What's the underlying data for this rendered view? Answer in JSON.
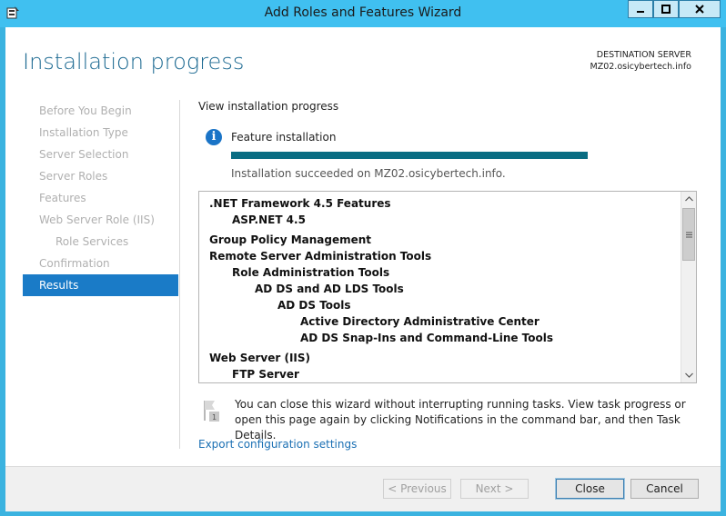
{
  "window": {
    "title": "Add Roles and Features Wizard",
    "controls": {
      "minimize": "minimize-icon",
      "maximize": "maximize-icon",
      "close": "close-icon"
    }
  },
  "header": {
    "title": "Installation progress",
    "destination_label": "DESTINATION SERVER",
    "destination_server": "MZ02.osicybertech.info"
  },
  "sidebar": {
    "items": [
      {
        "label": "Before You Begin",
        "state": "disabled"
      },
      {
        "label": "Installation Type",
        "state": "disabled"
      },
      {
        "label": "Server Selection",
        "state": "disabled"
      },
      {
        "label": "Server Roles",
        "state": "disabled"
      },
      {
        "label": "Features",
        "state": "disabled"
      },
      {
        "label": "Web Server Role (IIS)",
        "state": "disabled"
      },
      {
        "label": "Role Services",
        "state": "disabled",
        "sub": true
      },
      {
        "label": "Confirmation",
        "state": "disabled"
      },
      {
        "label": "Results",
        "state": "active"
      }
    ]
  },
  "main": {
    "view_label": "View installation progress",
    "feature_installation_label": "Feature installation",
    "progress_percent": 100,
    "status_text": "Installation succeeded on MZ02.osicybertech.info.",
    "results_list": [
      {
        "text": ".NET Framework 4.5 Features",
        "level": 0
      },
      {
        "text": "ASP.NET 4.5",
        "level": 1
      },
      {
        "text": "Group Policy Management",
        "level": 0,
        "gap": true
      },
      {
        "text": "Remote Server Administration Tools",
        "level": 0
      },
      {
        "text": "Role Administration Tools",
        "level": 1
      },
      {
        "text": "AD DS and AD LDS Tools",
        "level": 2
      },
      {
        "text": "AD DS Tools",
        "level": 3
      },
      {
        "text": "Active Directory Administrative Center",
        "level": 4
      },
      {
        "text": "AD DS Snap-Ins and Command-Line Tools",
        "level": 4
      },
      {
        "text": "Web Server (IIS)",
        "level": 0,
        "gap": true
      },
      {
        "text": "FTP Server",
        "level": 1
      }
    ],
    "note": "You can close this wizard without interrupting running tasks. View task progress or open this page again by clicking Notifications in the command bar, and then Task Details.",
    "export_link": "Export configuration settings"
  },
  "footer": {
    "previous": "< Previous",
    "next": "Next >",
    "close": "Close",
    "cancel": "Cancel"
  },
  "colors": {
    "accent": "#1a7bc7",
    "title_bar": "#40c0f0",
    "progress": "#0a6d83"
  }
}
